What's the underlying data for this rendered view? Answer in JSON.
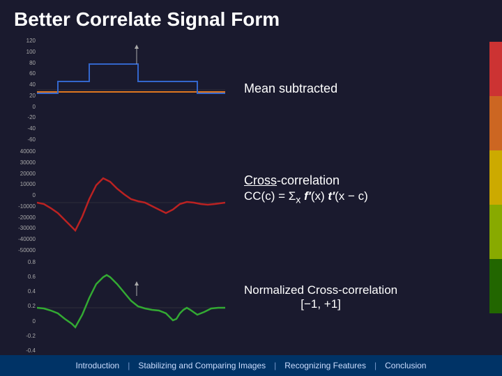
{
  "title": "Better Correlate Signal Form",
  "labels": {
    "mean_subtracted": "Mean subtracted",
    "cross_correlation": "Cross-correlation",
    "cc_formula": "CC(c) = Σ",
    "cc_formula_x": "x",
    "cc_formula_f": "f′",
    "cc_formula_mid": "(x) ",
    "cc_formula_t": "t′",
    "cc_formula_end": "(x − c)",
    "normalized_line1": "Normalized Cross-correlation",
    "normalized_line2": "[−1, +1]"
  },
  "chart_top_yaxis": [
    "120",
    "100",
    "80",
    "60",
    "40",
    "20",
    "0",
    "-20",
    "-40",
    "-60"
  ],
  "chart_mid_yaxis": [
    "40000",
    "30000",
    "20000",
    "10000",
    "0",
    "-10000",
    "-20000",
    "-30000",
    "-40000",
    "-50000"
  ],
  "chart_bot_yaxis": [
    "0.8",
    "0.6",
    "0.4",
    "0.2",
    "0",
    "-0.2",
    "-0.4"
  ],
  "nav": {
    "items": [
      {
        "label": "Introduction",
        "active": false
      },
      {
        "label": "Stabilizing and Comparing Images",
        "active": false
      },
      {
        "label": "Recognizing Features",
        "active": false
      },
      {
        "label": "Conclusion",
        "active": false
      }
    ],
    "separator": "|"
  },
  "accent_colors": [
    "#cc3333",
    "#cc6622",
    "#ccaa00",
    "#88aa00",
    "#226600"
  ]
}
